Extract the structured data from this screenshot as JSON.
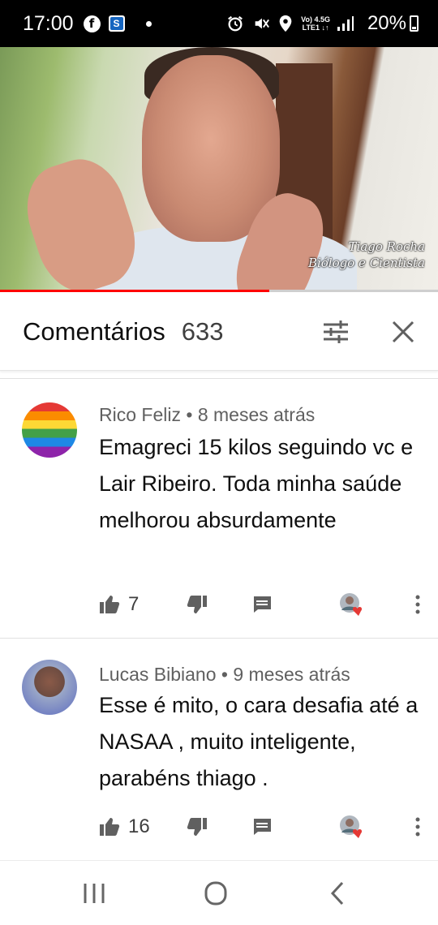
{
  "status_bar": {
    "time": "17:00",
    "icons": [
      "facebook-icon",
      "s-app-icon",
      "notification-dot",
      "alarm-icon",
      "mute-icon",
      "location-icon",
      "volte-icon",
      "signal-icon",
      "battery-icon"
    ],
    "network_top": "Vo) 4.5G",
    "network_bottom": "LTE1 ↓↑",
    "battery": "20%"
  },
  "video": {
    "watermark_line1": "Tiago Rocha",
    "watermark_line2": "Biólogo e Cientista",
    "progress": 0.615,
    "progress_color": "#ff0000"
  },
  "comments_header": {
    "title": "Comentários",
    "count": "633"
  },
  "comments": [
    {
      "author": "Rico Feliz",
      "time": "8 meses atrás",
      "text": "Emagreci 15 kilos seguindo vc e Lair Ribeiro. Toda minha saúde melhorou absurdamente",
      "likes": "7"
    },
    {
      "author": "Lucas Bibiano",
      "time": "9 meses atrás",
      "text": "Esse é mito, o cara desafia até a NASAA , muito inteligente, parabéns thiago .",
      "likes": "16"
    }
  ],
  "colors": {
    "heart": "#e53935",
    "text_primary": "#0f0f0f",
    "text_secondary": "#606060"
  },
  "nav": {
    "buttons": [
      "recent-apps-icon",
      "home-icon",
      "back-icon"
    ]
  }
}
